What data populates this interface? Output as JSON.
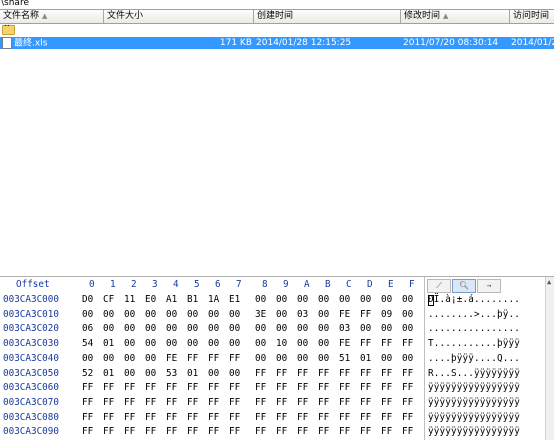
{
  "path": "\\share",
  "list": {
    "columns": [
      {
        "label": "文件名称",
        "sorted": true
      },
      {
        "label": "文件大小",
        "sorted": false
      },
      {
        "label": "创建时间",
        "sorted": false
      },
      {
        "label": "修改时间",
        "sorted": true
      },
      {
        "label": "访问时间",
        "sorted": false
      }
    ],
    "up_label": "..",
    "rows": [
      {
        "name": "最终.xls",
        "size": "171 KB",
        "created": "2014/01/28  12:15:25",
        "modified": "2011/07/20  08:30:14",
        "accessed": "2014/01/2"
      }
    ]
  },
  "hex": {
    "offset_label": "Offset",
    "columns": [
      "0",
      "1",
      "2",
      "3",
      "4",
      "5",
      "6",
      "7",
      "8",
      "9",
      "A",
      "B",
      "C",
      "D",
      "E",
      "F"
    ],
    "rows": [
      {
        "offset": "003CA3C000",
        "bytes": [
          "D0",
          "CF",
          "11",
          "E0",
          "A1",
          "B1",
          "1A",
          "E1",
          "00",
          "00",
          "00",
          "00",
          "00",
          "00",
          "00",
          "00"
        ],
        "ascii": "ÐÏ.à¡±.á........"
      },
      {
        "offset": "003CA3C010",
        "bytes": [
          "00",
          "00",
          "00",
          "00",
          "00",
          "00",
          "00",
          "00",
          "3E",
          "00",
          "03",
          "00",
          "FE",
          "FF",
          "09",
          "00"
        ],
        "ascii": "........>...þÿ.."
      },
      {
        "offset": "003CA3C020",
        "bytes": [
          "06",
          "00",
          "00",
          "00",
          "00",
          "00",
          "00",
          "00",
          "00",
          "00",
          "00",
          "00",
          "03",
          "00",
          "00",
          "00"
        ],
        "ascii": "................"
      },
      {
        "offset": "003CA3C030",
        "bytes": [
          "54",
          "01",
          "00",
          "00",
          "00",
          "00",
          "00",
          "00",
          "00",
          "10",
          "00",
          "00",
          "FE",
          "FF",
          "FF",
          "FF"
        ],
        "ascii": "T...........þÿÿÿ"
      },
      {
        "offset": "003CA3C040",
        "bytes": [
          "00",
          "00",
          "00",
          "00",
          "FE",
          "FF",
          "FF",
          "FF",
          "00",
          "00",
          "00",
          "00",
          "51",
          "01",
          "00",
          "00"
        ],
        "ascii": "....þÿÿÿ....Q..."
      },
      {
        "offset": "003CA3C050",
        "bytes": [
          "52",
          "01",
          "00",
          "00",
          "53",
          "01",
          "00",
          "00",
          "FF",
          "FF",
          "FF",
          "FF",
          "FF",
          "FF",
          "FF",
          "FF"
        ],
        "ascii": "R...S...ÿÿÿÿÿÿÿÿ"
      },
      {
        "offset": "003CA3C060",
        "bytes": [
          "FF",
          "FF",
          "FF",
          "FF",
          "FF",
          "FF",
          "FF",
          "FF",
          "FF",
          "FF",
          "FF",
          "FF",
          "FF",
          "FF",
          "FF",
          "FF"
        ],
        "ascii": "ÿÿÿÿÿÿÿÿÿÿÿÿÿÿÿÿ"
      },
      {
        "offset": "003CA3C070",
        "bytes": [
          "FF",
          "FF",
          "FF",
          "FF",
          "FF",
          "FF",
          "FF",
          "FF",
          "FF",
          "FF",
          "FF",
          "FF",
          "FF",
          "FF",
          "FF",
          "FF"
        ],
        "ascii": "ÿÿÿÿÿÿÿÿÿÿÿÿÿÿÿÿ"
      },
      {
        "offset": "003CA3C080",
        "bytes": [
          "FF",
          "FF",
          "FF",
          "FF",
          "FF",
          "FF",
          "FF",
          "FF",
          "FF",
          "FF",
          "FF",
          "FF",
          "FF",
          "FF",
          "FF",
          "FF"
        ],
        "ascii": "ÿÿÿÿÿÿÿÿÿÿÿÿÿÿÿÿ"
      },
      {
        "offset": "003CA3C090",
        "bytes": [
          "FF",
          "FF",
          "FF",
          "FF",
          "FF",
          "FF",
          "FF",
          "FF",
          "FF",
          "FF",
          "FF",
          "FF",
          "FF",
          "FF",
          "FF",
          "FF"
        ],
        "ascii": "ÿÿÿÿÿÿÿÿÿÿÿÿÿÿÿÿ"
      }
    ]
  },
  "colors": {
    "selection": "#3399ff",
    "offset_text": "#1a3a9c"
  }
}
